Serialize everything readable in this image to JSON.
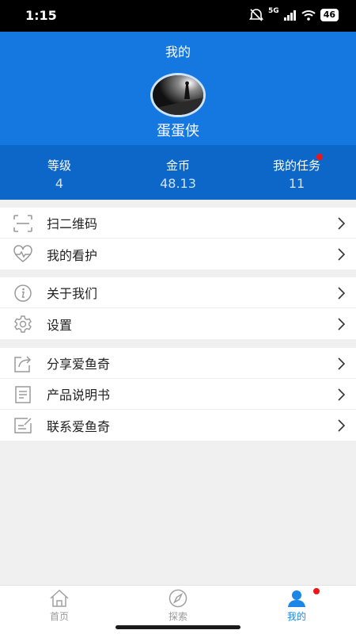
{
  "status": {
    "time": "1:15",
    "network": "5G",
    "battery": "46"
  },
  "header": {
    "title": "我的",
    "username": "蛋蛋侠"
  },
  "stats": [
    {
      "label": "等级",
      "value": "4"
    },
    {
      "label": "金币",
      "value": "48.13"
    },
    {
      "label": "我的任务",
      "value": "11"
    }
  ],
  "menu": {
    "group1": [
      {
        "label": "扫二维码",
        "icon": "qr-scan-icon"
      },
      {
        "label": "我的看护",
        "icon": "heart-pulse-icon"
      }
    ],
    "group2": [
      {
        "label": "关于我们",
        "icon": "info-icon"
      },
      {
        "label": "设置",
        "icon": "gear-icon"
      }
    ],
    "group3": [
      {
        "label": "分享爱鱼奇",
        "icon": "share-icon"
      },
      {
        "label": "产品说明书",
        "icon": "document-icon"
      },
      {
        "label": "联系爱鱼奇",
        "icon": "edit-icon"
      }
    ]
  },
  "tabs": [
    {
      "label": "首页",
      "icon": "home-icon"
    },
    {
      "label": "探索",
      "icon": "compass-icon"
    },
    {
      "label": "我的",
      "icon": "user-icon",
      "active": true
    }
  ],
  "colors": {
    "header": "#1577e0",
    "stats_bar": "#0d67c8",
    "accent": "#1a86e8",
    "badge": "#f01515"
  }
}
